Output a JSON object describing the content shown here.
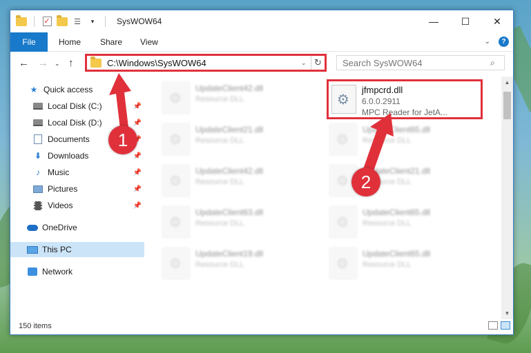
{
  "window": {
    "title": "SysWOW64",
    "controls": {
      "minimize": "—",
      "maximize": "☐",
      "close": "✕"
    }
  },
  "ribbon": {
    "tabs": [
      "File",
      "Home",
      "Share",
      "View"
    ]
  },
  "address": {
    "path": "C:\\Windows\\SysWOW64",
    "search_placeholder": "Search SysWOW64"
  },
  "sidebar": {
    "items": [
      {
        "label": "Quick access",
        "icon": "star-icon",
        "pinned": false,
        "selected": false
      },
      {
        "label": "Local Disk (C:)",
        "icon": "disk-icon",
        "pinned": true,
        "selected": false
      },
      {
        "label": "Local Disk (D:)",
        "icon": "disk-icon",
        "pinned": true,
        "selected": false
      },
      {
        "label": "Documents",
        "icon": "documents-icon",
        "pinned": true,
        "selected": false
      },
      {
        "label": "Downloads",
        "icon": "downloads-icon",
        "pinned": true,
        "selected": false
      },
      {
        "label": "Music",
        "icon": "music-icon",
        "pinned": true,
        "selected": false
      },
      {
        "label": "Pictures",
        "icon": "pictures-icon",
        "pinned": true,
        "selected": false
      },
      {
        "label": "Videos",
        "icon": "videos-icon",
        "pinned": true,
        "selected": false
      },
      {
        "label": "OneDrive",
        "icon": "onedrive-icon",
        "pinned": false,
        "selected": false
      },
      {
        "label": "This PC",
        "icon": "this-pc-icon",
        "pinned": false,
        "selected": true
      },
      {
        "label": "Network",
        "icon": "network-icon",
        "pinned": false,
        "selected": false
      }
    ]
  },
  "files": {
    "focus": {
      "name": "jfmpcrd.dll",
      "version": "6.0.0.2911",
      "description": "MPC Reader for JetA..."
    },
    "blurred_left": [
      {
        "name": "UpdateClient42.dll",
        "type": "Resource DLL"
      },
      {
        "name": "UpdateClient21.dll",
        "type": "Resource DLL"
      },
      {
        "name": "UpdateClient42.dll",
        "type": "Resource DLL"
      },
      {
        "name": "UpdateClient63.dll",
        "type": "Resource DLL"
      },
      {
        "name": "UpdateClient19.dll",
        "type": "Resource DLL"
      }
    ],
    "blurred_right": [
      {
        "name": "UpdateClient65.dll",
        "type": "Resource DLL"
      },
      {
        "name": "UpdateClient21.dll",
        "type": "Resource DLL"
      },
      {
        "name": "UpdateClient65.dll",
        "type": "Resource DLL"
      },
      {
        "name": "UpdateClient65.dll",
        "type": "Resource DLL"
      }
    ]
  },
  "status": {
    "item_count": "150 items"
  },
  "annotations": {
    "step1": "1",
    "step2": "2",
    "color": "#e0313b"
  }
}
